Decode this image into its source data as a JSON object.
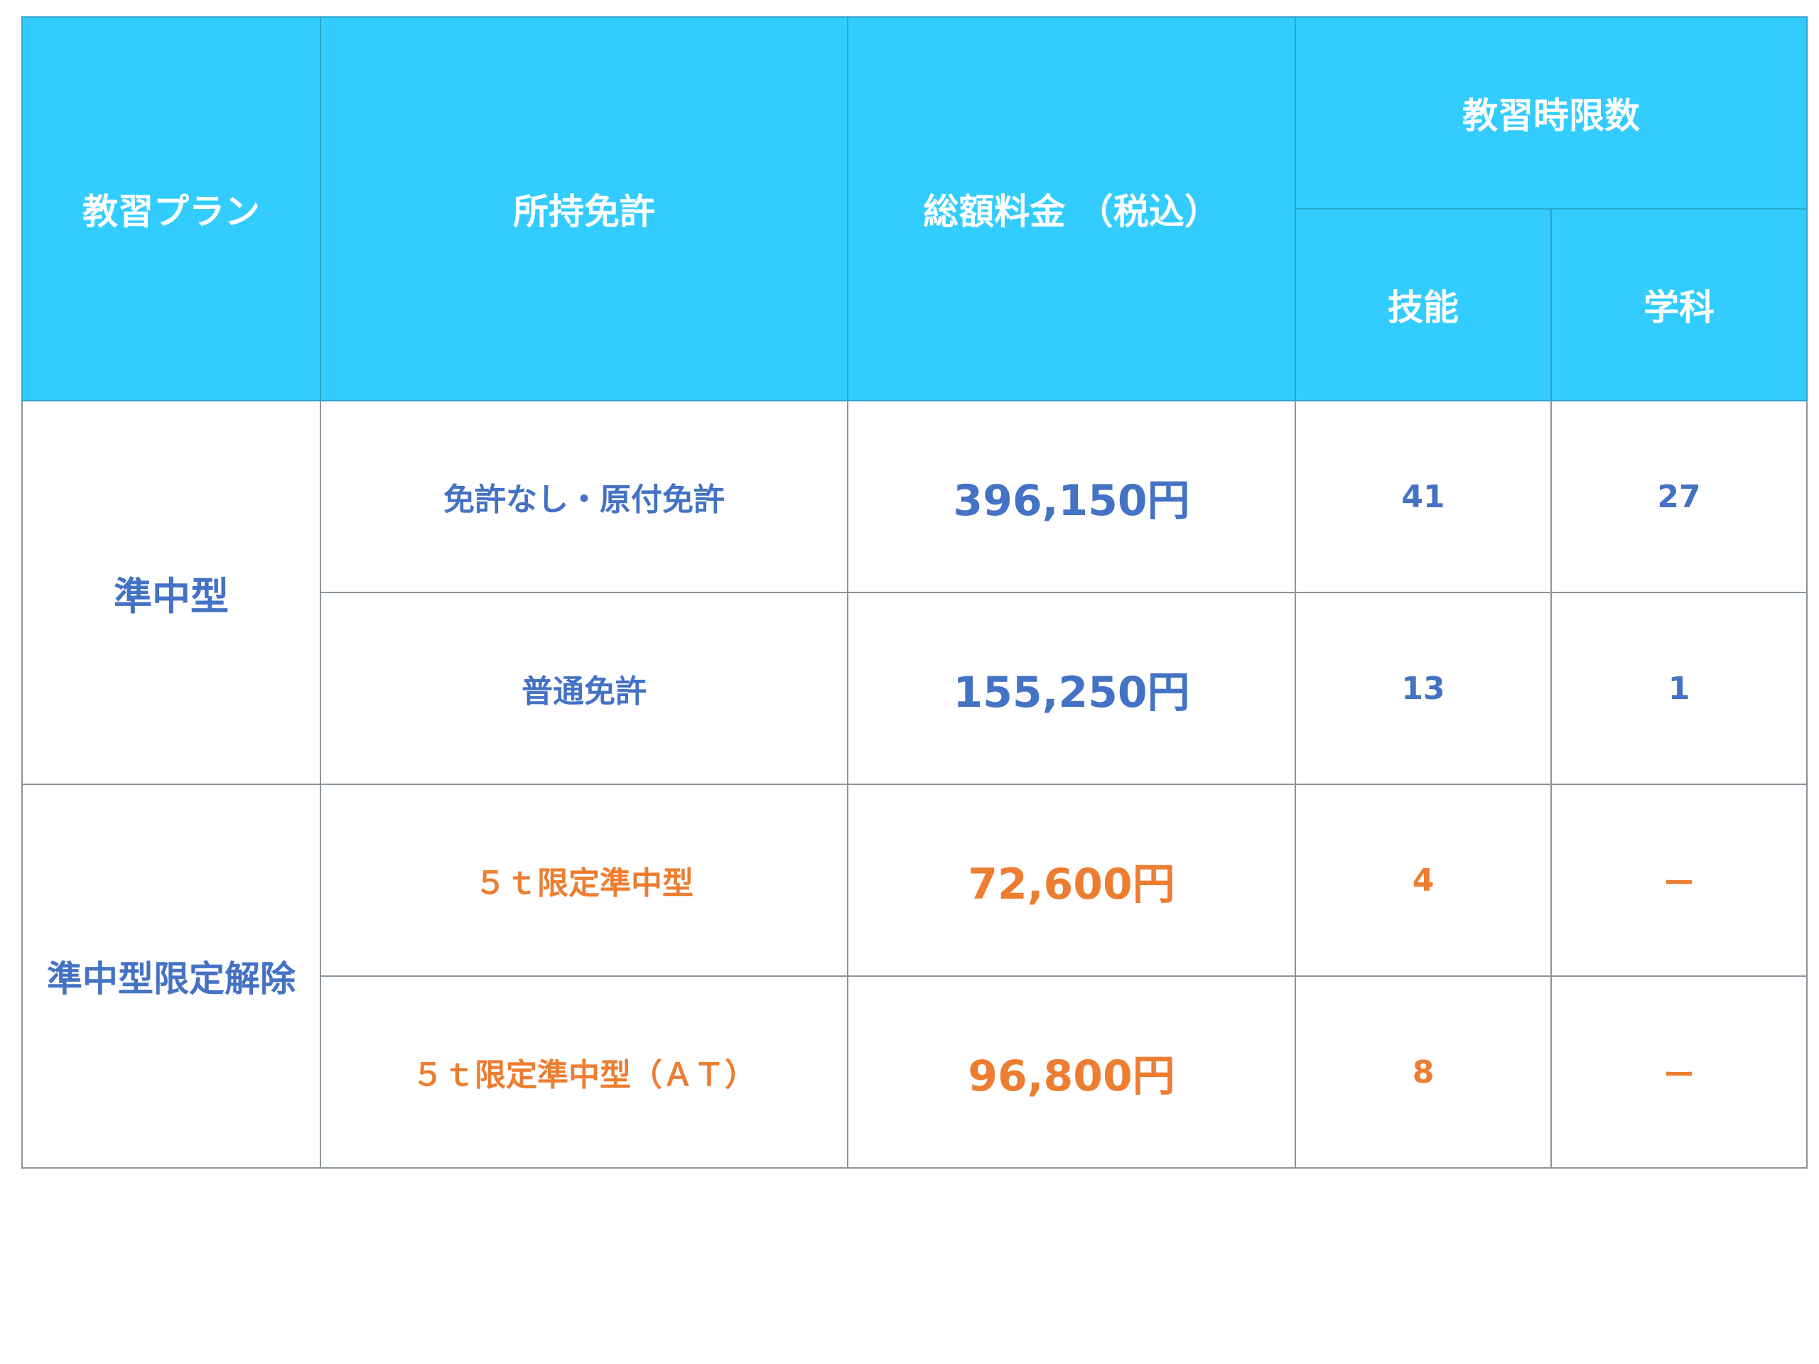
{
  "colors": {
    "header_bg": "#33ccff",
    "header_text": "#ffffff",
    "blue_text": "#4472c4",
    "orange_text": "#ed7d31",
    "border": "#8a949c"
  },
  "header": {
    "plan": "教習プラン",
    "license": "所持免許",
    "fee": "総額料金 （税込）",
    "hours": "教習時限数",
    "skill": "技能",
    "classroom": "学科"
  },
  "groups": [
    {
      "plan": "準中型",
      "rows": [
        {
          "license": "免許なし・原付免許",
          "fee": "396,150円",
          "skill": "41",
          "classroom": "27"
        },
        {
          "license": "普通免許",
          "fee": "155,250円",
          "skill": "13",
          "classroom": "1"
        }
      ]
    },
    {
      "plan": "準中型限定解除",
      "rows": [
        {
          "license": "５ｔ限定準中型",
          "fee": "72,600円",
          "skill": "4",
          "classroom": "ー"
        },
        {
          "license": "５ｔ限定準中型（ＡＴ）",
          "fee": "96,800円",
          "skill": "8",
          "classroom": "ー"
        }
      ]
    }
  ]
}
